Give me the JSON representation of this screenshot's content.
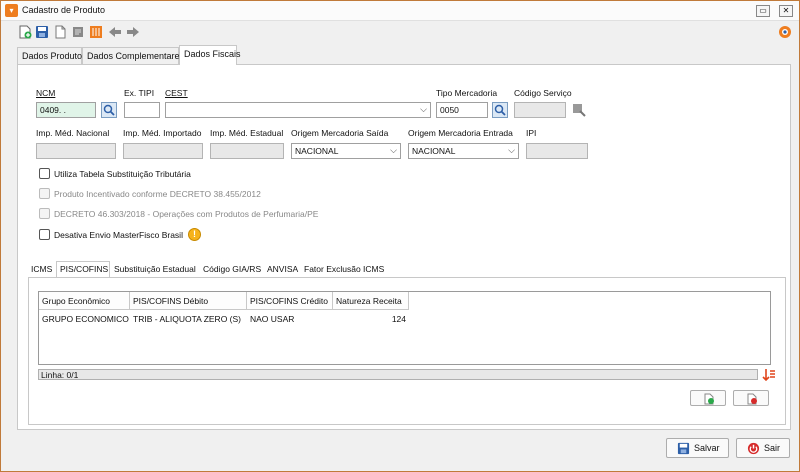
{
  "window": {
    "title": "Cadastro de Produto",
    "min_label": "▭",
    "close_label": "✕"
  },
  "tabs": [
    "Dados Produto",
    "Dados Complementares",
    "Dados Fiscais"
  ],
  "fields": {
    "ncm": {
      "label": "NCM",
      "value": "0409.    .  "
    },
    "ex_tipi": {
      "label": "Ex. TIPI",
      "value": ""
    },
    "cest": {
      "label": "CEST",
      "value": ""
    },
    "tipo_mercadoria": {
      "label": "Tipo Mercadoria",
      "value": "0050"
    },
    "codigo_servico": {
      "label": "Código Serviço",
      "value": ""
    },
    "imp_med_nacional": {
      "label": "Imp. Méd. Nacional",
      "value": ""
    },
    "imp_med_importado": {
      "label": "Imp. Méd. Importado",
      "value": ""
    },
    "imp_med_estadual": {
      "label": "Imp. Méd. Estadual",
      "value": ""
    },
    "origem_saida": {
      "label": "Origem Mercadoria Saída",
      "value": "NACIONAL"
    },
    "origem_entrada": {
      "label": "Origem Mercadoria Entrada",
      "value": "NACIONAL"
    },
    "ipi": {
      "label": "IPI",
      "value": ""
    }
  },
  "checkboxes": [
    {
      "label": "Utiliza Tabela Substituição Tributária",
      "checked": false,
      "enabled": true
    },
    {
      "label": "Produto Incentivado conforme DECRETO 38.455/2012",
      "checked": false,
      "enabled": false
    },
    {
      "label": "DECRETO 46.303/2018 - Operações com Produtos de Perfumaria/PE",
      "checked": false,
      "enabled": false
    },
    {
      "label": "Desativa Envio MasterFisco Brasil",
      "checked": false,
      "enabled": true
    }
  ],
  "warn_icon_label": "!",
  "subtabs": [
    "ICMS",
    "PIS/COFINS",
    "Substituição Estadual",
    "Código GIA/RS",
    "ANVISA",
    "Fator Exclusão ICMS"
  ],
  "grid": {
    "columns": [
      "Grupo Econômico",
      "PIS/COFINS Débito",
      "PIS/COFINS Crédito",
      "Natureza Receita"
    ],
    "rows": [
      [
        "GRUPO ECONOMICO",
        "TRIB - ALIQUOTA ZERO (S)",
        "NAO USAR",
        "124"
      ]
    ]
  },
  "status": {
    "linha": "Linha: 0/1"
  },
  "buttons": {
    "salvar": "Salvar",
    "sair": "Sair"
  },
  "colors": {
    "accent": "#ee7d1f",
    "border": "#c07a3a"
  }
}
